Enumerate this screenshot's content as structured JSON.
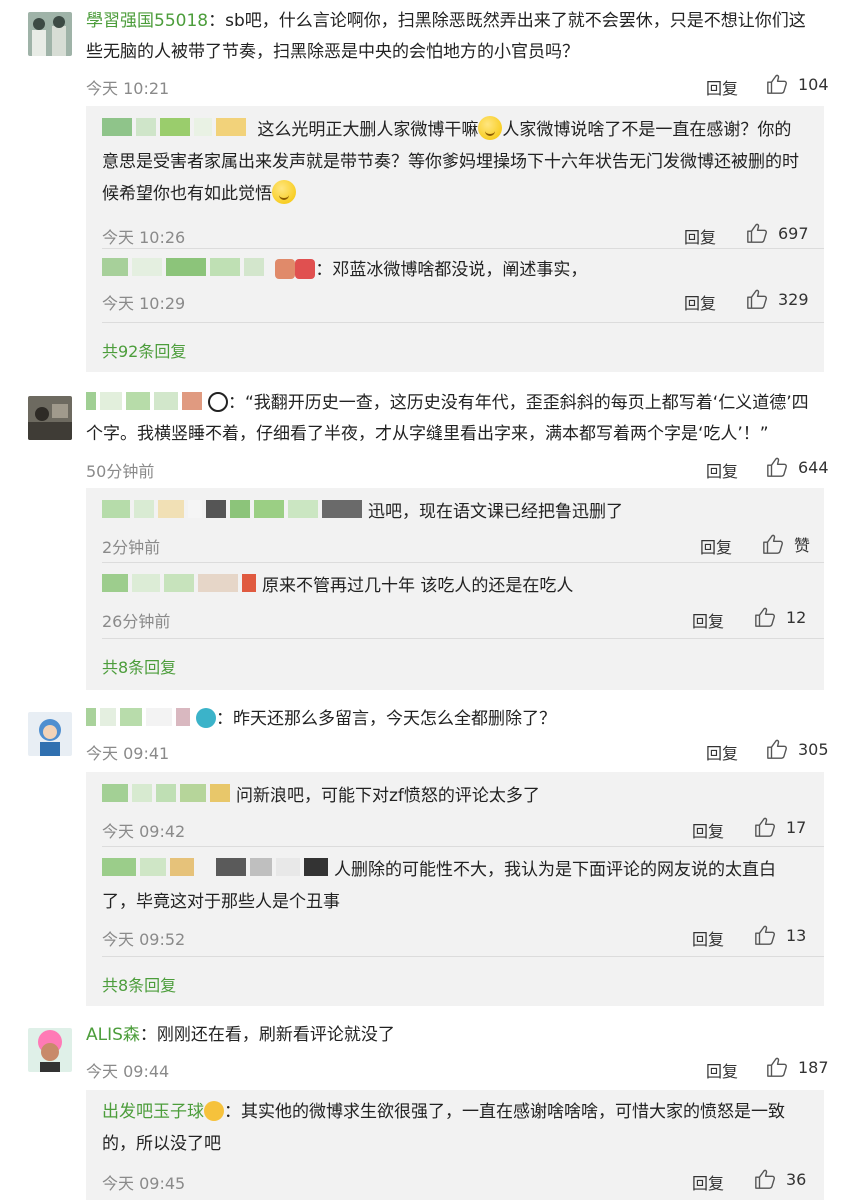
{
  "icons": {
    "like": "thumbs-up-icon"
  },
  "colors": {
    "username": "#eb7350",
    "link_green": "#4c9d3b",
    "reply_bg": "#f2f2f2",
    "meta": "#8a8a8a"
  },
  "comments": [
    {
      "username": "學習强国55018",
      "text": "：sb吧，什么言论啊你，扫黑除恶既然弄出来了就不会罢休，只是不想让你们这些无脑的人被带了节奏，扫黑除恶是中央的会怕地方的小官员吗？",
      "time": "今天 10:21",
      "reply": "回复",
      "likes": "104",
      "subs": [
        {
          "text_a": "这么光明正大删人家微博干嘛",
          "text_b": "人家微博说啥了不是一直在感谢？你的意思是受害者家属出来发声就是带节奏？等你爹妈埋操场下十六年状告无门发微博还被删的时候希望你也有如此觉悟",
          "time": "今天 10:26",
          "reply": "回复",
          "likes": "697"
        },
        {
          "text": "：邓蓝冰微博啥都没说，阐述事实，",
          "time": "今天 10:29",
          "reply": "回复",
          "likes": "329"
        }
      ],
      "more": "共92条回复"
    },
    {
      "text": "：“我翻开历史一查，这历史没有年代，歪歪斜斜的每页上都写着‘仁义道德’四个字。我横竖睡不着，仔细看了半夜，才从字缝里看出字来，满本都写着两个字是‘吃人’！”",
      "time": "50分钟前",
      "reply": "回复",
      "likes": "644",
      "subs": [
        {
          "text": "迅吧，现在语文课已经把鲁迅删了",
          "time": "2分钟前",
          "reply": "回复",
          "likes": "赞"
        },
        {
          "text": "原来不管再过几十年 该吃人的还是在吃人",
          "time": "26分钟前",
          "reply": "回复",
          "likes": "12"
        }
      ],
      "more": "共8条回复"
    },
    {
      "text": "：昨天还那么多留言，今天怎么全都删除了？",
      "time": "今天 09:41",
      "reply": "回复",
      "likes": "305",
      "subs": [
        {
          "text": "问新浪吧，可能下对zf愤怒的评论太多了",
          "time": "今天 09:42",
          "reply": "回复",
          "likes": "17"
        },
        {
          "text": "人删除的可能性不大，我认为是下面评论的网友说的太直白了，毕竟这对于那些人是个丑事",
          "time": "今天 09:52",
          "reply": "回复",
          "likes": "13"
        }
      ],
      "more": "共8条回复"
    },
    {
      "username": "ALIS森",
      "text": "：刚刚还在看，刷新看评论就没了",
      "time": "今天 09:44",
      "reply": "回复",
      "likes": "187",
      "subs": [
        {
          "username": "出发吧玉子球",
          "text": "：其实他的微博求生欲很强了，一直在感谢啥啥啥，可惜大家的愤怒是一致的，所以没了吧",
          "time": "今天 09:45",
          "reply": "回复",
          "likes": "36"
        }
      ]
    }
  ]
}
